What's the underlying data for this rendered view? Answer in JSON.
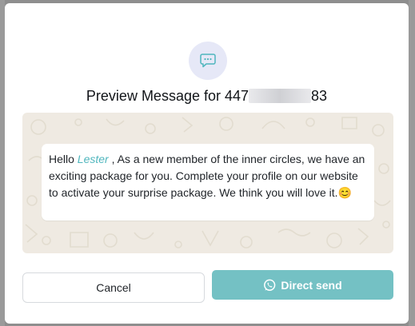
{
  "modal": {
    "title_prefix": "Preview Message for 447",
    "title_suffix": "83",
    "icon": "chat-bubble-icon"
  },
  "message": {
    "greeting": "Hello",
    "name": "Lester",
    "text": " , As a new member of the inner circles, we have an exciting package for you. Complete your profile on our website to activate your surprise package. We think you will love it.",
    "emoji": "😊"
  },
  "buttons": {
    "cancel_label": "Cancel",
    "send_label": "Direct send",
    "send_icon": "whatsapp-icon"
  },
  "colors": {
    "accent": "#74c1c4",
    "name_highlight": "#4fb6bd",
    "icon_bg": "#e6e8f7",
    "chat_bg": "#efeae2"
  }
}
